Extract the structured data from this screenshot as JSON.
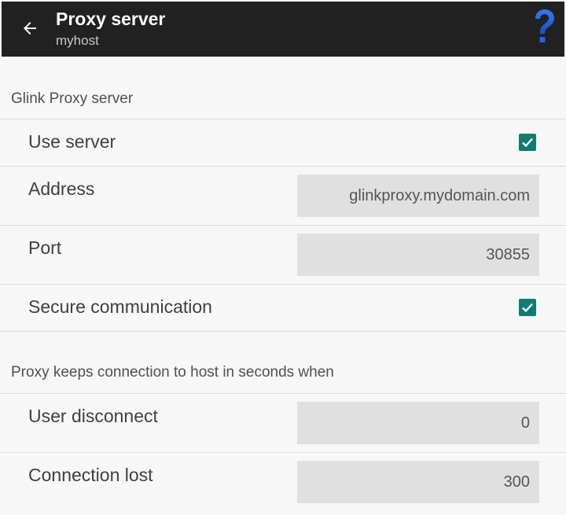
{
  "app_bar": {
    "title": "Proxy server",
    "subtitle": "myhost",
    "back_icon": "arrow-left-icon",
    "help_icon": "question-mark-icon",
    "help_color": "#1e64e6"
  },
  "sections": {
    "glink": {
      "header": "Glink Proxy server",
      "use_server": {
        "label": "Use server",
        "checked": true
      },
      "address": {
        "label": "Address",
        "value": "glinkproxy.mydomain.com"
      },
      "port": {
        "label": "Port",
        "value": "30855"
      },
      "secure": {
        "label": "Secure communication",
        "checked": true
      }
    },
    "keep": {
      "header": "Proxy keeps connection to host in seconds when",
      "user_disconnect": {
        "label": "User disconnect",
        "value": "0"
      },
      "connection_lost": {
        "label": "Connection lost",
        "value": "300"
      }
    }
  },
  "colors": {
    "app_bar": "#212121",
    "checkbox_accent": "#0f7d70",
    "field_background": "#e0e0e0"
  }
}
